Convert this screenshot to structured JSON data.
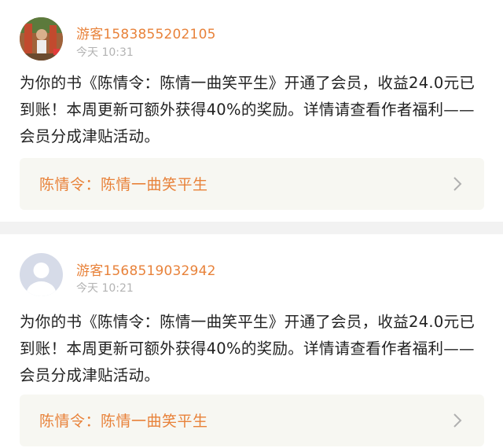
{
  "notifications": [
    {
      "username": "游客1583855202105",
      "time": "今天 10:31",
      "message": "为你的书《陈情令：陈情一曲笑平生》开通了会员，收益24.0元已到账！本周更新可额外获得40%的奖励。详情请查看作者福利——会员分成津贴活动。",
      "book_title": "陈情令：陈情一曲笑平生",
      "avatar_icon": "photo-avatar-icon",
      "chevron_icon": "chevron-right-icon"
    },
    {
      "username": "游客1568519032942",
      "time": "今天 10:21",
      "message": "为你的书《陈情令：陈情一曲笑平生》开通了会员，收益24.0元已到账！本周更新可额外获得40%的奖励。详情请查看作者福利——会员分成津贴活动。",
      "book_title": "陈情令：陈情一曲笑平生",
      "avatar_icon": "default-avatar-icon",
      "chevron_icon": "chevron-right-icon"
    }
  ],
  "colors": {
    "accent": "#e8823a",
    "link_background": "#f7f7f2",
    "divider": "#f2f2f2",
    "meta_text": "#b3b3b3",
    "body_text": "#222222"
  }
}
